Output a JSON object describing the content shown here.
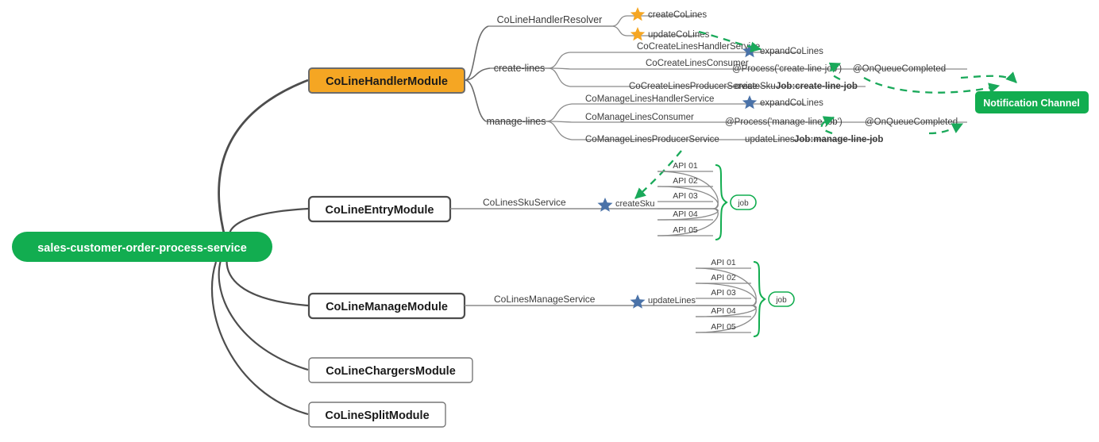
{
  "diagram": {
    "type": "mindmap",
    "root": {
      "label": "sales-customer-order-process-service",
      "color": "#12ad50",
      "text_color": "#ffffff"
    },
    "accent_colors": {
      "green": "#12ad50",
      "orange": "#f5a623",
      "star_orange": "#f5a623",
      "star_blue": "#4a72a8",
      "branch_grey": "#4d4d4d",
      "dashed_green": "#1aa95a",
      "label_grey": "#3c3c3c"
    },
    "modules": [
      {
        "label": "CoLineHandlerModule",
        "style": "orange-filled"
      },
      {
        "label": "CoLineEntryModule",
        "style": "white-bold-border"
      },
      {
        "label": "CoLineManageModule",
        "style": "white-bold-border"
      },
      {
        "label": "CoLineChargersModule",
        "style": "white-thin-border"
      },
      {
        "label": "CoLineSplitModule",
        "style": "white-thin-border"
      }
    ],
    "handler_module": {
      "branches": [
        {
          "label": "CoLineHandlerResolver",
          "children": [
            {
              "label": "createCoLines",
              "icon": "star-icon",
              "icon_color": "orange"
            },
            {
              "label": "updateCoLines",
              "icon": "star-icon",
              "icon_color": "orange"
            }
          ]
        },
        {
          "label": "create-lines",
          "children": [
            {
              "label": "CoCreateLinesHandlerService",
              "annotations": [
                {
                  "text": "expandCoLines",
                  "icon": "star-icon",
                  "icon_color": "blue"
                }
              ]
            },
            {
              "label": "CoCreateLinesConsumer",
              "annotations": [
                {
                  "text": "@Process('create-line-job')"
                },
                {
                  "text": "@OnQueueCompleted"
                }
              ]
            },
            {
              "label": "CoCreateLinesProducerService",
              "annotations": [
                {
                  "text": "createSku"
                },
                {
                  "text": "Job:create-line-job",
                  "bold": true
                }
              ]
            }
          ]
        },
        {
          "label": "manage-lines",
          "children": [
            {
              "label": "CoManageLinesHandlerService",
              "annotations": [
                {
                  "text": "expandCoLines",
                  "icon": "star-icon",
                  "icon_color": "blue"
                }
              ]
            },
            {
              "label": "CoManageLinesConsumer",
              "annotations": [
                {
                  "text": "@Process('manage-line-job')"
                },
                {
                  "text": "@OnQueueCompleted"
                }
              ]
            },
            {
              "label": "CoManageLinesProducerService",
              "annotations": [
                {
                  "text": "updateLines"
                },
                {
                  "text": "Job:manage-line-job",
                  "bold": true
                }
              ]
            }
          ]
        }
      ]
    },
    "notification_channel": {
      "label": "Notification Channel",
      "color": "#12ad50",
      "text_color": "#ffffff"
    },
    "entry_module": {
      "service": "CoLinesSkuService",
      "method": {
        "label": "createSku",
        "icon": "star-icon",
        "icon_color": "blue"
      },
      "apis": [
        "API 01",
        "API 02",
        "API 03",
        "API 04",
        "API 05"
      ],
      "group_label": "job"
    },
    "manage_module": {
      "service": "CoLinesManageService",
      "method": {
        "label": "updateLines",
        "icon": "star-icon",
        "icon_color": "blue"
      },
      "apis": [
        "API 01",
        "API 02",
        "API 03",
        "API 04",
        "API 05"
      ],
      "group_label": "job"
    }
  }
}
